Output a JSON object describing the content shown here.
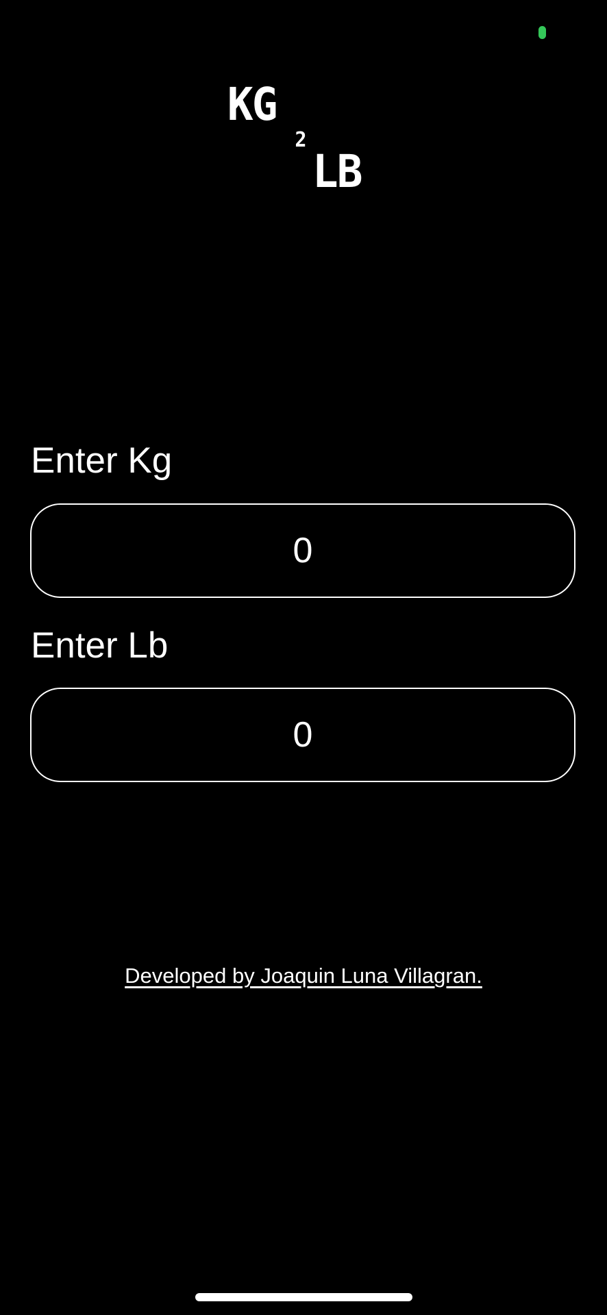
{
  "status_bar": {
    "indicator_color": "#34c759"
  },
  "logo": {
    "part1": "KG",
    "part2": "2",
    "part3": "LB"
  },
  "kg_field": {
    "label": "Enter Kg",
    "value": "0"
  },
  "lb_field": {
    "label": "Enter Lb",
    "value": "0"
  },
  "footer": {
    "credit": "Developed by Joaquin Luna Villagran."
  }
}
